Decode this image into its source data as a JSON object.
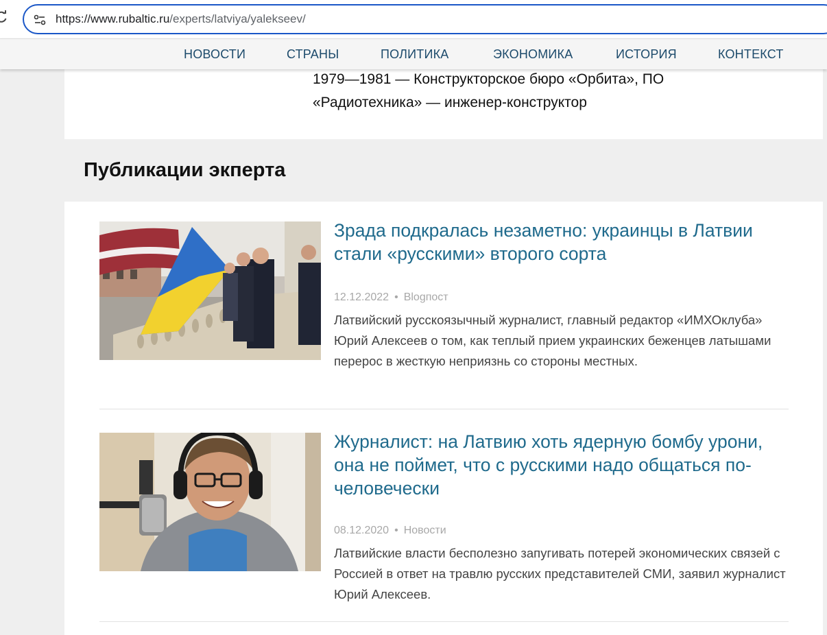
{
  "browser": {
    "url_host": "https://www.rubaltic.ru",
    "url_path": "/experts/latviya/yalekseev/"
  },
  "nav": {
    "items": [
      "НОВОСТИ",
      "СТРАНЫ",
      "ПОЛИТИКА",
      "ЭКОНОМИКА",
      "ИСТОРИЯ",
      "КОНТЕКСТ"
    ]
  },
  "bio": {
    "line1": "1979—1981 — Конструкторское бюро «Орбита», ПО",
    "line2": "«Радиотехника» — инженер-конструктор"
  },
  "section": {
    "title": "Публикации экперта"
  },
  "articles": [
    {
      "title": "Зрада подкралась незаметно: украинцы в Латвии стали «русскими» второго сорта",
      "date": "12.12.2022",
      "category": "Blogпост",
      "description": "Латвийский русскоязычный журналист, главный редактор «ИМХОклуба» Юрий Алексеев о том, как теплый прием украинских беженцев латышами перерос в жесткую неприязнь со стороны местных."
    },
    {
      "title": "Журналист: на Латвию хоть ядерную бомбу урони, она не поймет, что с русскими надо общаться по-человечески",
      "date": "08.12.2020",
      "category": "Новости",
      "description": "Латвийские власти бесполезно запугивать потерей экономических связей с Россией в ответ на травлю русских представителей СМИ, заявил журналист Юрий Алексеев."
    }
  ],
  "colors": {
    "nav_text": "#1c4a6b",
    "article_title": "#1f6a8c",
    "address_border": "#1a57c7"
  }
}
